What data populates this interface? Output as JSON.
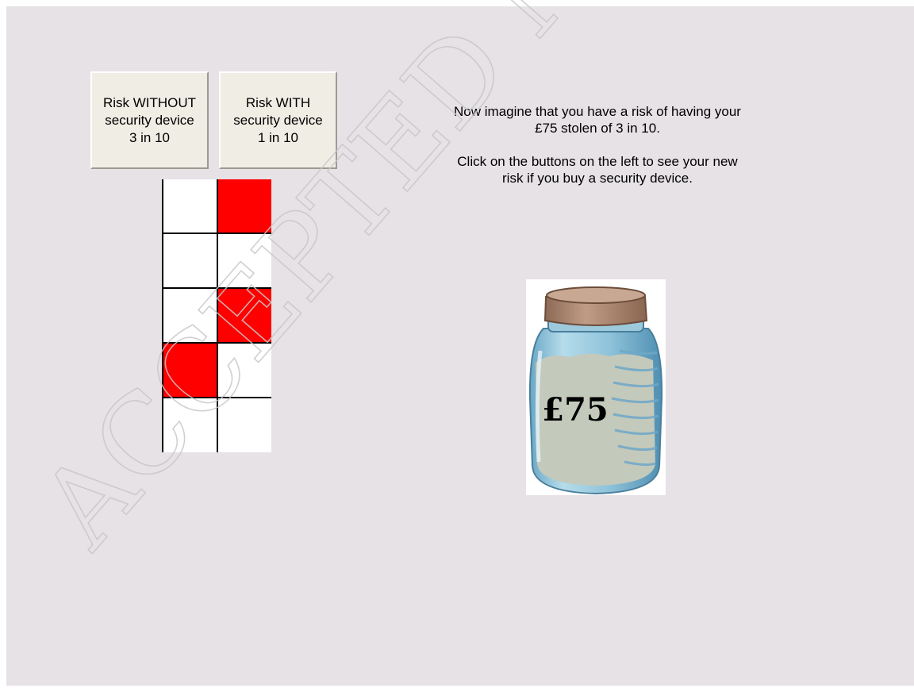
{
  "buttons": {
    "without": {
      "line1": "Risk WITHOUT",
      "line2": "security device",
      "line3": "3 in 10"
    },
    "with": {
      "line1": "Risk WITH",
      "line2": "security device",
      "line3": "1 in 10"
    }
  },
  "risk_grid": {
    "rows": 5,
    "cols": 2,
    "cells": [
      [
        "white",
        "red"
      ],
      [
        "white",
        "white"
      ],
      [
        "white",
        "red"
      ],
      [
        "red",
        "white"
      ],
      [
        "white",
        "white"
      ]
    ],
    "highlighted_count": 3,
    "total": 10
  },
  "instructions": {
    "paragraph1": "Now imagine that you have a risk of having your £75 stolen of 3 in 10.",
    "paragraph2": "Click on the buttons on the left to see your new risk if you buy a security device."
  },
  "jar": {
    "label": "£75",
    "icon": "money-jar-icon"
  },
  "watermark": {
    "text": "ACCEPTED MANUSCRIPT"
  },
  "colors": {
    "background": "#e6e2e6",
    "risk_cell": "#ff0000",
    "safe_cell": "#ffffff",
    "button_face": "#efede4",
    "jar_lid": "#a5826c",
    "jar_glass": "#8fc3da",
    "jar_contents": "#c3c9bb",
    "watermark": "#d0d0d0"
  }
}
